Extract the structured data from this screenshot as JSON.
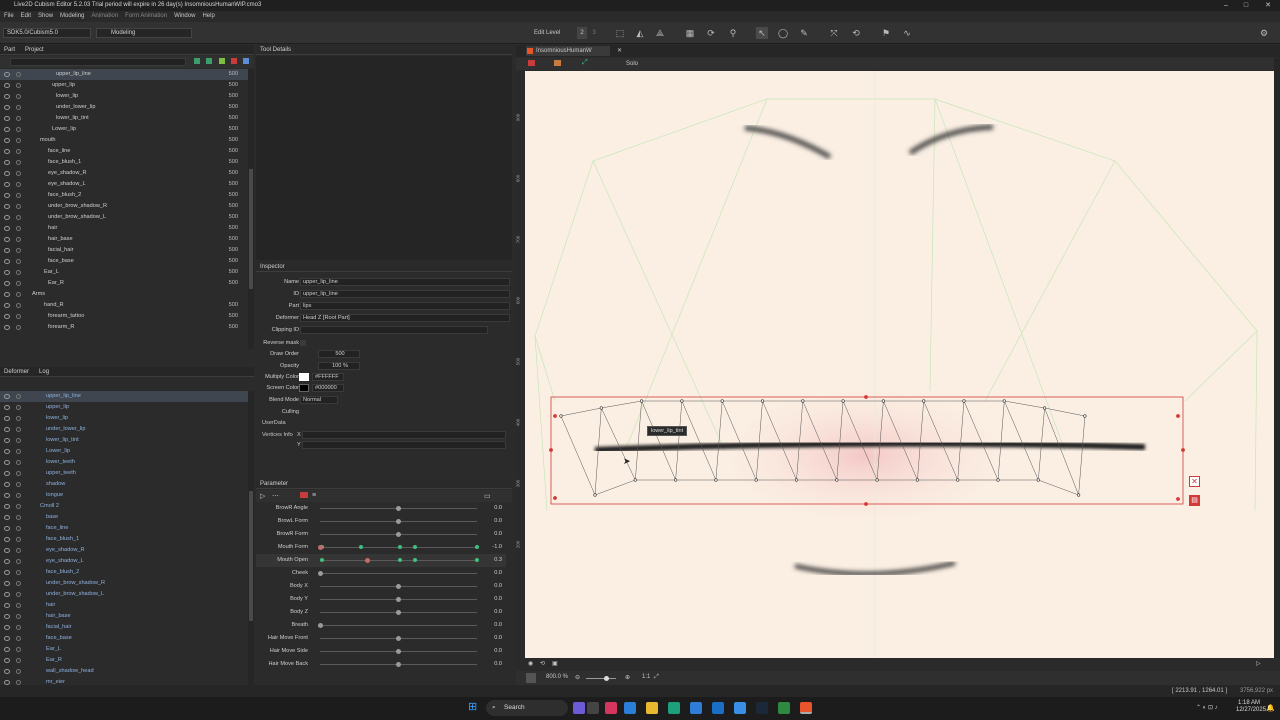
{
  "titlebar": {
    "title": "Live2D Cubism Editor 5.2.03    Trial period will expire in 26 day(s)    InsomniousHumanWIP.cmo3"
  },
  "menu": [
    "File",
    "Edit",
    "Show",
    "Modeling",
    "Animation",
    "Form Animation",
    "Window",
    "Help"
  ],
  "toolbar": {
    "sdk": "SDK5.0/Cubism5.0",
    "mode": "Modeling",
    "edit_level_label": "Edit Level",
    "levels": [
      "2",
      "3"
    ]
  },
  "part_panel": {
    "tabs": [
      "Part",
      "Project"
    ],
    "rows": [
      {
        "label": "upper_lip_line",
        "value": "500",
        "selected": true
      },
      {
        "label": "upper_lip",
        "value": "500"
      },
      {
        "label": "lower_lip",
        "value": "500"
      },
      {
        "label": "under_lower_lip",
        "value": "500"
      },
      {
        "label": "lower_lip_tint",
        "value": "500"
      },
      {
        "label": "Lower_lip",
        "value": "500"
      },
      {
        "label": "mouth",
        "value": "500"
      },
      {
        "label": "face_line",
        "value": "500"
      },
      {
        "label": "face_blush_1",
        "value": "500"
      },
      {
        "label": "eye_shadow_R",
        "value": "500"
      },
      {
        "label": "eye_shadow_L",
        "value": "500"
      },
      {
        "label": "face_blush_2",
        "value": "500"
      },
      {
        "label": "under_brow_shadow_R",
        "value": "500"
      },
      {
        "label": "under_brow_shadow_L",
        "value": "500"
      },
      {
        "label": "hair",
        "value": "500"
      },
      {
        "label": "hair_base",
        "value": "500"
      },
      {
        "label": "facial_hair",
        "value": "500"
      },
      {
        "label": "face_base",
        "value": "500"
      },
      {
        "label": "Ear_L",
        "value": "500"
      },
      {
        "label": "Ear_R",
        "value": "500"
      },
      {
        "label": "Arms",
        "value": ""
      },
      {
        "label": "hand_R",
        "value": "500"
      },
      {
        "label": "forearm_tattoo",
        "value": "500"
      },
      {
        "label": "forearm_R",
        "value": "500"
      }
    ]
  },
  "deformer_panel": {
    "tabs": [
      "Deformer",
      "Log"
    ],
    "rows": [
      "upper_lip_line",
      "upper_lip",
      "lower_lip",
      "under_lower_lip",
      "lower_lip_tint",
      "Lower_lip",
      "lower_teeth",
      "upper_teeth",
      "shadow",
      "tongue",
      "Cmoll 2",
      "base",
      "face_line",
      "face_blush_1",
      "eye_shadow_R",
      "eye_shadow_L",
      "face_blush_2",
      "under_brow_shadow_R",
      "under_brow_shadow_L",
      "hair",
      "hair_base",
      "facial_hair",
      "face_base",
      "Ear_L",
      "Ear_R",
      "wall_shadow_head",
      "mr_eier"
    ]
  },
  "tool_details": {
    "title": "Tool Details"
  },
  "inspector": {
    "title": "Inspector",
    "name_label": "Name",
    "name": "upper_lip_line",
    "id_label": "ID",
    "id": "upper_lip_line",
    "part_label": "Part",
    "part": "lips",
    "deformer_label": "Deformer",
    "deformer": "Head Z [Root Part]",
    "clipping_label": "Clipping ID",
    "reverse_mask_label": "Reverse mask",
    "draw_order_label": "Draw Order",
    "draw_order": "500",
    "opacity_label": "Opacity",
    "opacity": "100 %",
    "multiply_label": "Multiply Color",
    "multiply": "#FFFFFF",
    "screen_label": "Screen Color",
    "screen": "#000000",
    "blend_label": "Blend Mode",
    "blend": "Normal",
    "culling_label": "Culling",
    "userdata_label": "UserData",
    "vertices_label": "Vertices Info",
    "vx": "X",
    "vy": "Y"
  },
  "parameters": {
    "title": "Parameter",
    "rows": [
      {
        "name": "BrowR Angle",
        "value": "0.0",
        "pos": 0.5
      },
      {
        "name": "BrowL Form",
        "value": "0.0",
        "pos": 0.5
      },
      {
        "name": "BrowR Form",
        "value": "0.0",
        "pos": 0.5
      },
      {
        "name": "Mouth Form",
        "value": "-1.0",
        "pos": 0.0,
        "keys": [
          0.0,
          0.25,
          0.5,
          0.6,
          1.0
        ]
      },
      {
        "name": "Mouth Open",
        "value": "0.3",
        "pos": 0.3,
        "keys": [
          0.0,
          0.5,
          0.6,
          1.0
        ]
      },
      {
        "name": "Cheek",
        "value": "0.0",
        "pos": 0.0
      },
      {
        "name": "Body X",
        "value": "0.0",
        "pos": 0.5
      },
      {
        "name": "Body Y",
        "value": "0.0",
        "pos": 0.5
      },
      {
        "name": "Body Z",
        "value": "0.0",
        "pos": 0.5
      },
      {
        "name": "Breath",
        "value": "0.0",
        "pos": 0.0
      },
      {
        "name": "Hair Move Front",
        "value": "0.0",
        "pos": 0.5
      },
      {
        "name": "Hair Move Side",
        "value": "0.0",
        "pos": 0.5
      },
      {
        "name": "Hair Move Back",
        "value": "0.0",
        "pos": 0.5
      }
    ]
  },
  "viewport": {
    "tab": "InsomniousHumanW",
    "solo": "Solo",
    "tooltip": "lower_lip_tint",
    "ruler": [
      "900",
      "800",
      "700",
      "600",
      "500",
      "400",
      "300",
      "200"
    ],
    "zoom": "800.0 %",
    "ratio": "1:1",
    "coords": "[ 2213.91 , 1264.01 ]",
    "size": "3756,922 px"
  },
  "taskbar": {
    "search": "Search",
    "time": "1:18 AM",
    "date": "12/27/2025"
  },
  "colors": {
    "accent": "#e8542b",
    "mesh": "#d23a3a",
    "keyframe": "#3fbf7f"
  }
}
